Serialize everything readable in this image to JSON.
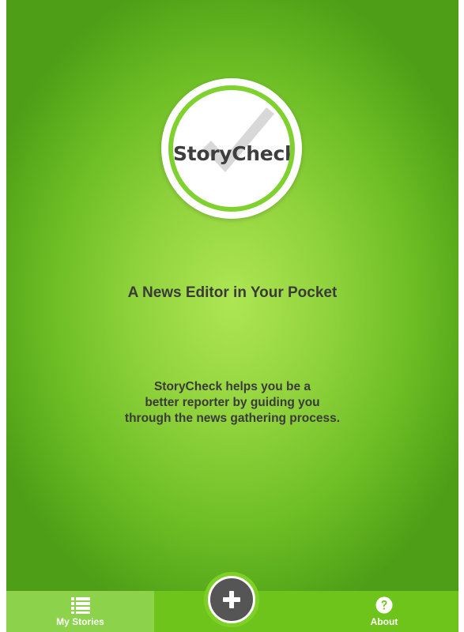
{
  "app": {
    "logo_text": "StoryCheck",
    "tagline": "A News Editor in Your Pocket",
    "description_lines": [
      "StoryCheck helps you be a",
      "better reporter by guiding you",
      "through the news gathering process."
    ]
  },
  "tabbar": {
    "tabs": [
      {
        "label": "My Stories",
        "icon": "list-icon",
        "active": true
      },
      {
        "label": "About",
        "icon": "question-circle-icon",
        "active": false
      }
    ],
    "add_button": {
      "icon": "plus-icon"
    }
  },
  "colors": {
    "brand_green": "#6fc41b",
    "active_tab": "#8cd24a",
    "text_dark": "#3a3a3a",
    "add_button": "#555555"
  }
}
